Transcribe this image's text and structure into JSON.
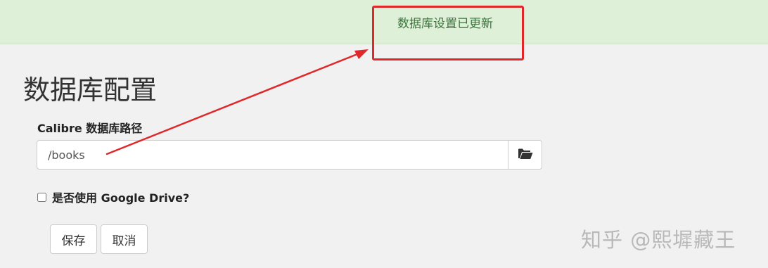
{
  "flash": {
    "message": "数据库设置已更新"
  },
  "page": {
    "title": "数据库配置"
  },
  "db_path": {
    "label": "Calibre 数据库路径",
    "value": "/books"
  },
  "google_drive": {
    "label": "是否使用 Google Drive?",
    "checked": false
  },
  "buttons": {
    "save": "保存",
    "cancel": "取消"
  },
  "watermark": "知乎 @熙墀藏王",
  "icons": {
    "folder": "folder-open-icon"
  },
  "colors": {
    "flash_bg": "#dff0d8",
    "flash_text": "#3c763d",
    "annotation": "#e0282a"
  }
}
